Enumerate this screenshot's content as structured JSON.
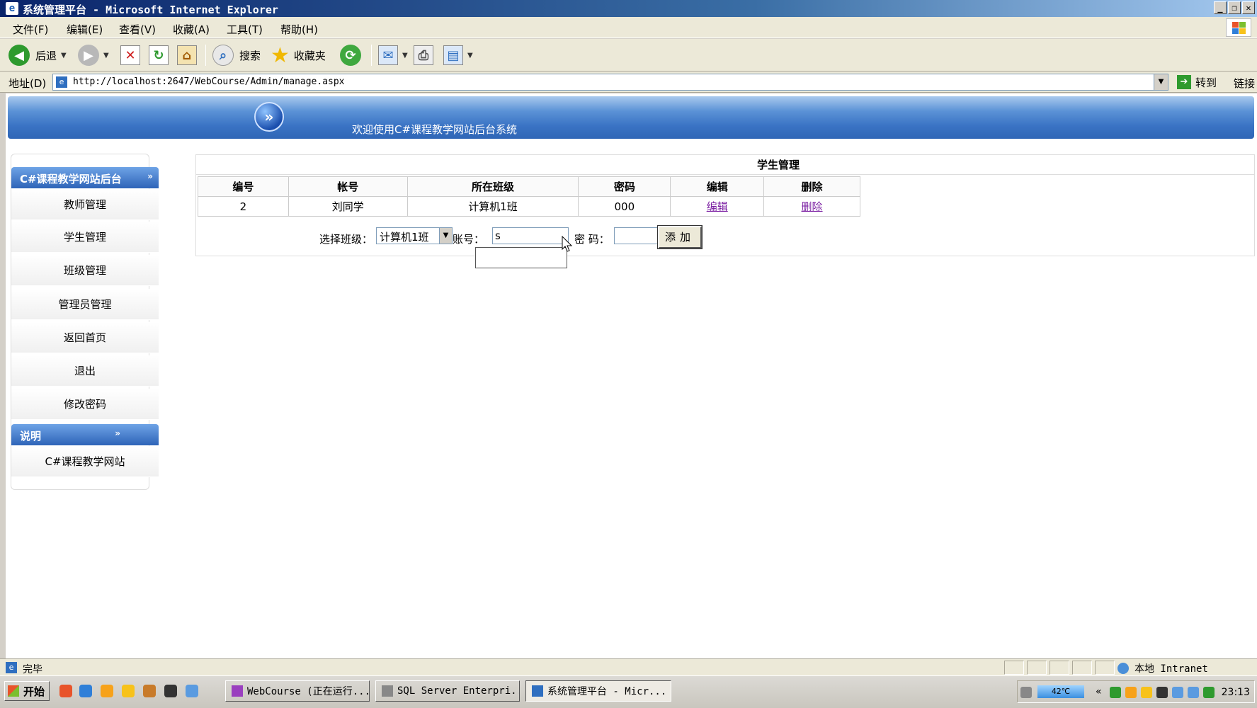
{
  "window": {
    "title": "系统管理平台 - Microsoft Internet Explorer",
    "min_label": "_",
    "restore_label": "❐",
    "close_label": "✕"
  },
  "menu": [
    "文件(F)",
    "编辑(E)",
    "查看(V)",
    "收藏(A)",
    "工具(T)",
    "帮助(H)"
  ],
  "toolbar": {
    "back_label": "后退",
    "search_label": "搜索",
    "favorites_label": "收藏夹"
  },
  "address": {
    "label": "地址(D)",
    "url": "http://localhost:2647/WebCourse/Admin/manage.aspx",
    "go_label": "转到",
    "links_label": "链接"
  },
  "banner": {
    "welcome": "欢迎使用C#课程教学网站后台系统"
  },
  "sidebar": {
    "header": "C#课程教学网站后台",
    "items": [
      "教师管理",
      "学生管理",
      "班级管理",
      "管理员管理",
      "返回首页",
      "退出",
      "修改密码"
    ],
    "info_header": "说明",
    "info_item": "C#课程教学网站"
  },
  "main": {
    "title": "学生管理",
    "columns": [
      "编号",
      "帐号",
      "所在班级",
      "密码",
      "编辑",
      "删除"
    ],
    "rows": [
      {
        "id": "2",
        "account": "刘同学",
        "class": "计算机1班",
        "password": "000",
        "edit": "编辑",
        "delete": "删除"
      }
    ],
    "form": {
      "class_label": "选择班级：",
      "class_value": "计算机1班",
      "account_label": "账号：",
      "account_value": "s",
      "password_label": "密 码：",
      "password_value": "",
      "add_label": "添加"
    }
  },
  "status": {
    "text": "完毕",
    "zone": "本地 Intranet"
  },
  "taskbar": {
    "start_label": "开始",
    "tasks": [
      "WebCourse (正在运行...",
      "SQL Server Enterpri...",
      "系统管理平台 - Micr..."
    ],
    "temperature": "42℃",
    "clock": "23:13"
  }
}
